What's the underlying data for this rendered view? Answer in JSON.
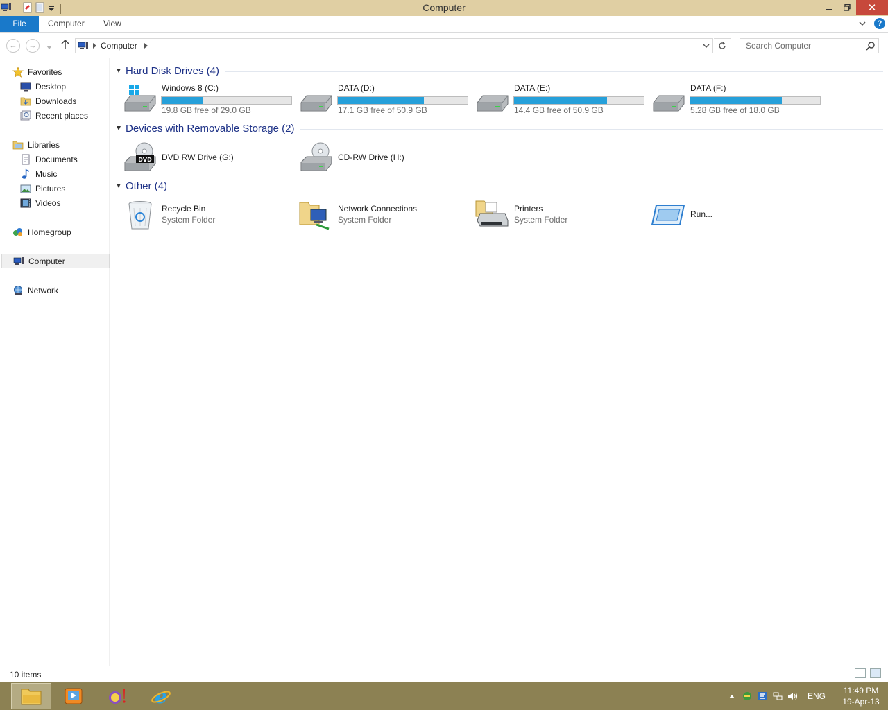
{
  "window": {
    "title": "Computer"
  },
  "ribbon": {
    "tabs": [
      "File",
      "Computer",
      "View"
    ]
  },
  "address": {
    "crumb": "Computer"
  },
  "search": {
    "placeholder": "Search Computer"
  },
  "navpane": {
    "favorites": "Favorites",
    "desktop": "Desktop",
    "downloads": "Downloads",
    "recent": "Recent places",
    "libraries": "Libraries",
    "documents": "Documents",
    "music": "Music",
    "pictures": "Pictures",
    "videos": "Videos",
    "homegroup": "Homegroup",
    "computer": "Computer",
    "network": "Network"
  },
  "groups": {
    "hdd": "Hard Disk Drives (4)",
    "removable": "Devices with Removable Storage (2)",
    "other": "Other (4)"
  },
  "drives": [
    {
      "name": "Windows 8 (C:)",
      "free": "19.8 GB free of 29.0 GB",
      "used_fraction": 0.317
    },
    {
      "name": "DATA (D:)",
      "free": "17.1 GB free of 50.9 GB",
      "used_fraction": 0.664
    },
    {
      "name": "DATA (E:)",
      "free": "14.4 GB free of 50.9 GB",
      "used_fraction": 0.717
    },
    {
      "name": "DATA (F:)",
      "free": "5.28 GB free of 18.0 GB",
      "used_fraction": 0.707
    }
  ],
  "removable": [
    {
      "name": "DVD RW Drive (G:)",
      "badge": "DVD"
    },
    {
      "name": "CD-RW Drive (H:)"
    }
  ],
  "other": [
    {
      "name": "Recycle Bin",
      "sub": "System Folder"
    },
    {
      "name": "Network Connections",
      "sub": "System Folder"
    },
    {
      "name": "Printers",
      "sub": "System Folder"
    },
    {
      "name": "Run..."
    }
  ],
  "status": {
    "count": "10 items"
  },
  "tray": {
    "lang": "ENG",
    "time": "11:49 PM",
    "date": "19-Apr-13"
  },
  "colors": {
    "accent": "#1979ca",
    "bar_fill": "#26a0da",
    "titlebar": "#e0cfa3",
    "taskbar": "#8c8153",
    "close": "#c7493b"
  }
}
